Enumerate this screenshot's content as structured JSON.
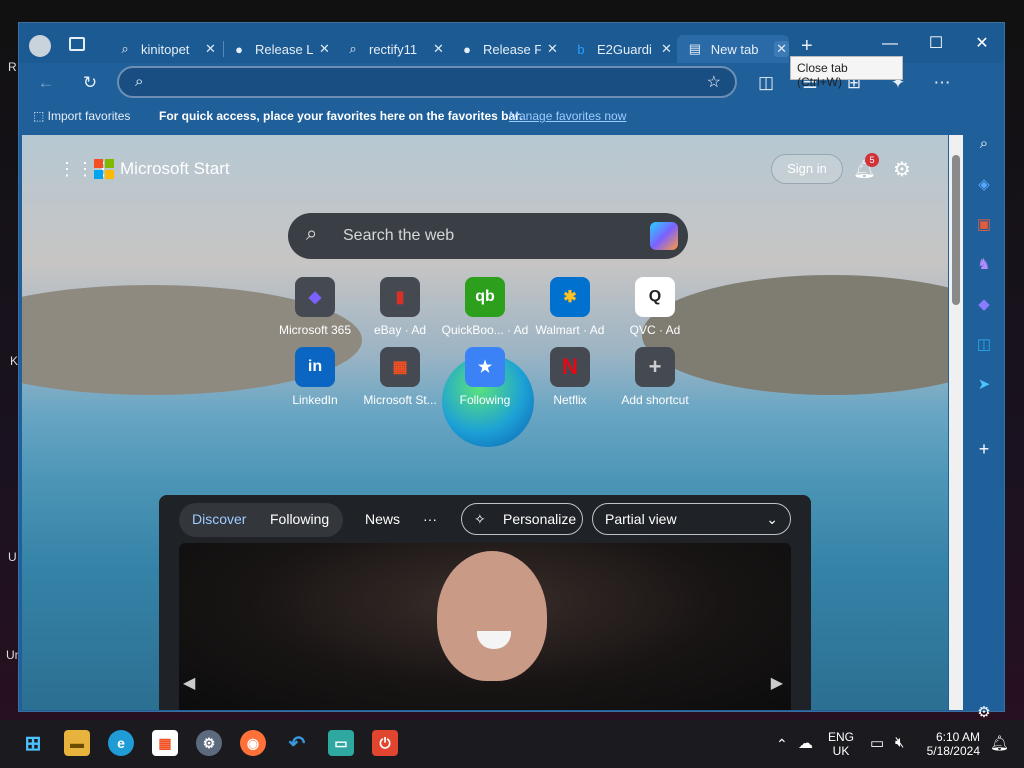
{
  "desktop": {
    "labels": [
      "R",
      "K",
      "U",
      "Un"
    ]
  },
  "browser": {
    "tabs": [
      {
        "label": "kinitopet",
        "icon": "search-icon"
      },
      {
        "label": "Release L",
        "icon": "github-icon"
      },
      {
        "label": "rectify11",
        "icon": "search-icon"
      },
      {
        "label": "Release F",
        "icon": "github-icon"
      },
      {
        "label": "E2Guardi",
        "icon": "bing-icon"
      },
      {
        "label": "New tab",
        "icon": "newtab-icon",
        "active": true
      }
    ],
    "tooltip": "Close tab (Ctrl+W)",
    "address": {
      "value": "",
      "placeholder": ""
    },
    "favorites_bar": {
      "import_label": "Import favorites",
      "message": "For quick access, place your favorites here on the favorites bar.",
      "link": "Manage favorites now"
    }
  },
  "newtab": {
    "brand": "Microsoft Start",
    "sign_in": "Sign in",
    "notification_count": "5",
    "search_placeholder": "Search the web",
    "shortcuts_row1": [
      {
        "label": "Microsoft 365",
        "icon_text": "◆",
        "color": "#7b61ff"
      },
      {
        "label": "eBay · Ad",
        "icon_text": "▮",
        "color": "#d93025"
      },
      {
        "label": "QuickBoo... · Ad",
        "icon_text": "qb",
        "color": "#2ca01c"
      },
      {
        "label": "Walmart · Ad",
        "icon_text": "✱",
        "color": "#0071ce"
      },
      {
        "label": "QVC · Ad",
        "icon_text": "Q",
        "color": "#ffffff"
      }
    ],
    "shortcuts_row2": [
      {
        "label": "LinkedIn",
        "icon_text": "in",
        "color": "#0a66c2"
      },
      {
        "label": "Microsoft St...",
        "icon_text": "▦",
        "color": "#f25022"
      },
      {
        "label": "Following",
        "icon_text": "★",
        "color": "#3b82f6"
      },
      {
        "label": "Netflix",
        "icon_text": "N",
        "color": "#e50914"
      },
      {
        "label": "Add shortcut",
        "icon_text": "+",
        "color": "#cfcfcf"
      }
    ],
    "feed": {
      "tabs": [
        "Discover",
        "Following",
        "News"
      ],
      "more": "···",
      "personalize": "Personalize",
      "view_select": "Partial view"
    }
  },
  "taskbar": {
    "lang_top": "ENG",
    "lang_bottom": "UK",
    "time": "6:10 AM",
    "date": "5/18/2024"
  }
}
